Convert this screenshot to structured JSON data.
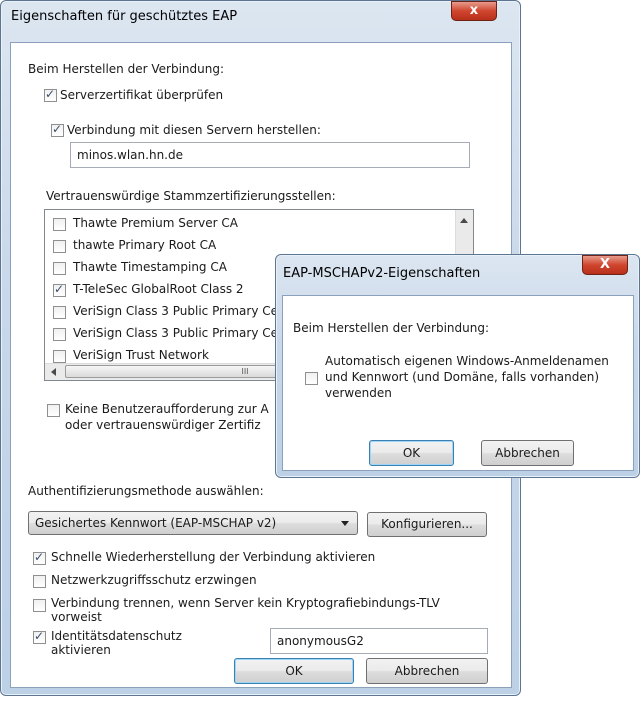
{
  "main_dialog": {
    "title": "Eigenschaften für geschütztes EAP",
    "close_label": "x",
    "section_label": "Beim Herstellen der Verbindung:",
    "verify_cert": {
      "label": "Serverzertifikat überprüfen",
      "checked": true
    },
    "connect_servers": {
      "label": "Verbindung mit diesen Servern herstellen:",
      "checked": true
    },
    "server_value": "minos.wlan.hn.de",
    "trusted_ca_label": "Vertrauenswürdige Stammzertifizierungsstellen:",
    "ca_items": [
      {
        "label": "Thawte Premium Server CA",
        "checked": false
      },
      {
        "label": "thawte Primary Root CA",
        "checked": false
      },
      {
        "label": "Thawte Timestamping CA",
        "checked": false
      },
      {
        "label": "T-TeleSec GlobalRoot Class 2",
        "checked": true
      },
      {
        "label": "VeriSign Class 3 Public Primary Ce",
        "checked": false
      },
      {
        "label": "VeriSign Class 3 Public Primary Ce",
        "checked": false
      },
      {
        "label": "VeriSign Trust Network",
        "checked": false
      }
    ],
    "scroll_thumb_text": "III",
    "no_prompt_line1": "Keine Benutzeraufforderung zur A",
    "no_prompt_line2": "oder vertrauenswürdiger Zertifiz",
    "auth_method_label": "Authentifizierungsmethode auswählen:",
    "auth_method_value": "Gesichertes Kennwort (EAP-MSCHAP v2)",
    "configure_label": "Konfigurieren...",
    "fast_reconnect": {
      "label": "Schnelle Wiederherstellung der Verbindung aktivieren",
      "checked": true
    },
    "nap": {
      "label": "Netzwerkzugriffsschutz erzwingen",
      "checked": false
    },
    "disconnect_line1": "Verbindung trennen, wenn Server kein Kryptografiebindungs-TLV",
    "disconnect_line2": "vorweist",
    "identity_line1": "Identitätsdatenschutz",
    "identity_line2": "aktivieren",
    "identity_value": "anonymousG2",
    "ok_label": "OK",
    "cancel_label": "Abbrechen"
  },
  "mschap_dialog": {
    "title": "EAP-MSCHAPv2-Eigenschaften",
    "close_label": "X",
    "section_label": "Beim Herstellen der Verbindung:",
    "auto_line1": "Automatisch eigenen Windows-Anmeldenamen",
    "auto_line2": "und Kennwort (und Domäne, falls vorhanden)",
    "auto_line3": "verwenden",
    "ok_label": "OK",
    "cancel_label": "Abbrechen"
  }
}
